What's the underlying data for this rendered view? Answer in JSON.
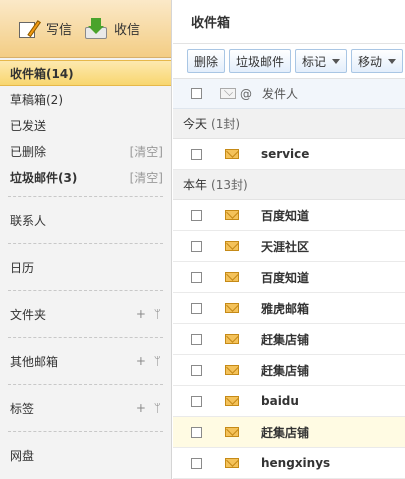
{
  "sidebar": {
    "compose_label": "写信",
    "receive_label": "收信",
    "folders": [
      {
        "label": "收件箱(14)",
        "clear": ""
      },
      {
        "label": "草稿箱(2)",
        "clear": ""
      },
      {
        "label": "已发送",
        "clear": ""
      },
      {
        "label": "已删除",
        "clear": "[清空]"
      },
      {
        "label": "垃圾邮件(3)",
        "clear": "[清空]"
      }
    ],
    "contacts": "联系人",
    "calendar": "日历",
    "folder_section": "文件夹",
    "other_mail": "其他邮箱",
    "tags": "标签",
    "netdisk": "网盘",
    "plus_marks": "+ ᛘ"
  },
  "main": {
    "title": "收件箱",
    "toolbar": {
      "delete": "删除",
      "spam": "垃圾邮件",
      "mark": "标记",
      "move": "移动"
    },
    "columns": {
      "clip": "@",
      "sender": "发件人"
    },
    "groups": [
      {
        "label": "今天",
        "count": "(1封)"
      },
      {
        "label": "本年",
        "count": "(13封)"
      }
    ],
    "today_rows": [
      {
        "sender": "service"
      }
    ],
    "year_rows": [
      {
        "sender": "百度知道"
      },
      {
        "sender": "天涯社区"
      },
      {
        "sender": "百度知道"
      },
      {
        "sender": "雅虎邮箱"
      },
      {
        "sender": "赶集店铺"
      },
      {
        "sender": "赶集店铺"
      },
      {
        "sender": "baidu"
      },
      {
        "sender": "赶集店铺"
      },
      {
        "sender": "hengxinys"
      }
    ]
  }
}
